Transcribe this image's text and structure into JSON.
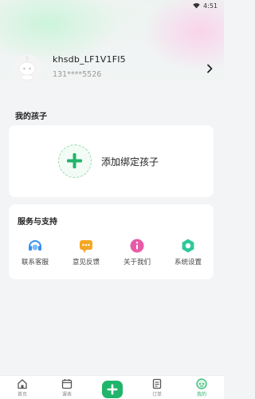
{
  "status_bar": {
    "time": "4:51",
    "wifi_icon": "wifi-icon"
  },
  "profile": {
    "nickname": "khsdb_LF1V1FI5",
    "phone": "131****5526",
    "avatar_icon": "robot-avatar-icon",
    "chevron_icon": "chevron-right-icon"
  },
  "children": {
    "title": "我的孩子",
    "add_label": "添加绑定孩子",
    "add_icon": "plus-icon"
  },
  "services": {
    "title": "服务与支持",
    "items": [
      {
        "label": "联系客服",
        "icon": "headset-icon",
        "color": "#3a8ff0"
      },
      {
        "label": "意见反馈",
        "icon": "chat-bubble-icon",
        "color": "#f5a623"
      },
      {
        "label": "关于我们",
        "icon": "info-icon",
        "color": "#e85aa8"
      },
      {
        "label": "系统设置",
        "icon": "gear-icon",
        "color": "#2fc99b"
      }
    ]
  },
  "tabbar": {
    "items": [
      {
        "label": "首页",
        "icon": "home-icon",
        "active": false
      },
      {
        "label": "课表",
        "icon": "calendar-icon",
        "active": false
      },
      {
        "label": "订单",
        "icon": "order-icon",
        "active": false
      },
      {
        "label": "我的",
        "icon": "profile-robot-icon",
        "active": true
      }
    ],
    "center_icon": "plus-icon"
  },
  "colors": {
    "accent": "#21b46b",
    "background": "#f3f4f6",
    "card": "#ffffff"
  }
}
